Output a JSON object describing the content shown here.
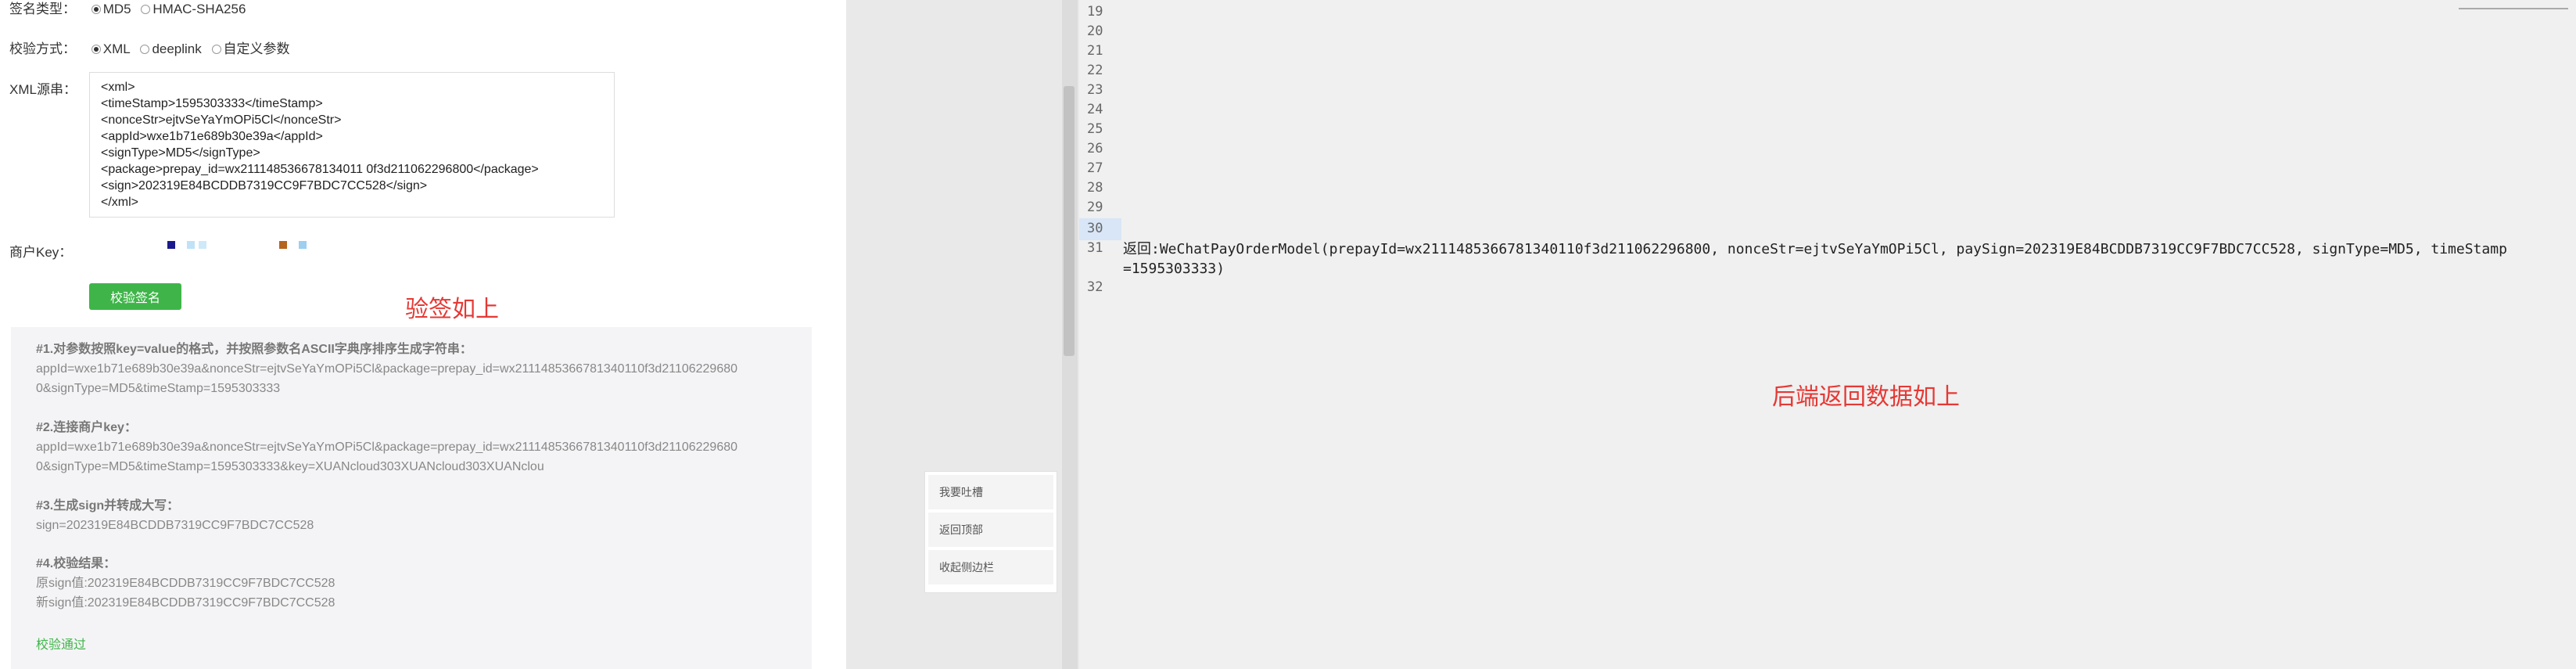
{
  "form": {
    "sign_type_label": "签名类型：",
    "sign_type_options": [
      "MD5",
      "HMAC-SHA256"
    ],
    "verify_method_label": "校验方式：",
    "verify_method_options": [
      "XML",
      "deeplink",
      "自定义参数"
    ],
    "xml_label": "XML源串：",
    "xml_lines": [
      "<xml>",
      "<timeStamp>1595303333</timeStamp>",
      "<nonceStr>ejtvSeYaYmOPi5Cl</nonceStr>",
      "<appId>wxe1b71e689b30e39a</appId>",
      "<signType>MD5</signType>",
      "<package>prepay_id=wx211148536678134011 0f3d211062296800</package>",
      "<sign>202319E84BCDDB7319CC9F7BDC7CC528</sign>",
      "</xml>"
    ],
    "merchant_key_label": "商户Key：",
    "verify_button": "校验签名"
  },
  "annotation_left": "验签如上",
  "steps": {
    "s1_title": "#1.对参数按照key=value的格式，并按照参数名ASCII字典序排序生成字符串：",
    "s1_line1": "appId=wxe1b71e689b30e39a&nonceStr=ejtvSeYaYmOPi5Cl&package=prepay_id=wx2111485366781340110f3d21106229680",
    "s1_line2": "0&signType=MD5&timeStamp=1595303333",
    "s2_title": "#2.连接商户key：",
    "s2_line1": "appId=wxe1b71e689b30e39a&nonceStr=ejtvSeYaYmOPi5Cl&package=prepay_id=wx2111485366781340110f3d21106229680",
    "s2_line2": "0&signType=MD5&timeStamp=1595303333&key=XUANcloud303XUANcloud303XUANclou",
    "s3_title": "#3.生成sign并转成大写：",
    "s3_line1": "sign=202319E84BCDDB7319CC9F7BDC7CC528",
    "s4_title": "#4.校验结果：",
    "s4_line1": "原sign值:202319E84BCDDB7319CC9F7BDC7CC528",
    "s4_line2": "新sign值:202319E84BCDDB7319CC9F7BDC7CC528",
    "result": "校验通过"
  },
  "float_menu": [
    "我要吐槽",
    "返回顶部",
    "收起侧边栏"
  ],
  "editor": {
    "line_numbers": [
      "19",
      "20",
      "21",
      "22",
      "23",
      "24",
      "25",
      "26",
      "27",
      "28",
      "29",
      "30",
      "31",
      "32"
    ],
    "code_line": "返回:WeChatPayOrderModel(prepayId=wx2111485366781340110f3d211062296800, nonceStr=ejtvSeYaYmOPi5Cl, paySign=202319E84BCDDB7319CC9F7BDC7CC528, signType=MD5, timeStamp=1595303333)"
  },
  "annotation_right": "后端返回数据如上",
  "colors": {
    "accent_green": "#3fb549",
    "annotation_red": "#e53935"
  }
}
